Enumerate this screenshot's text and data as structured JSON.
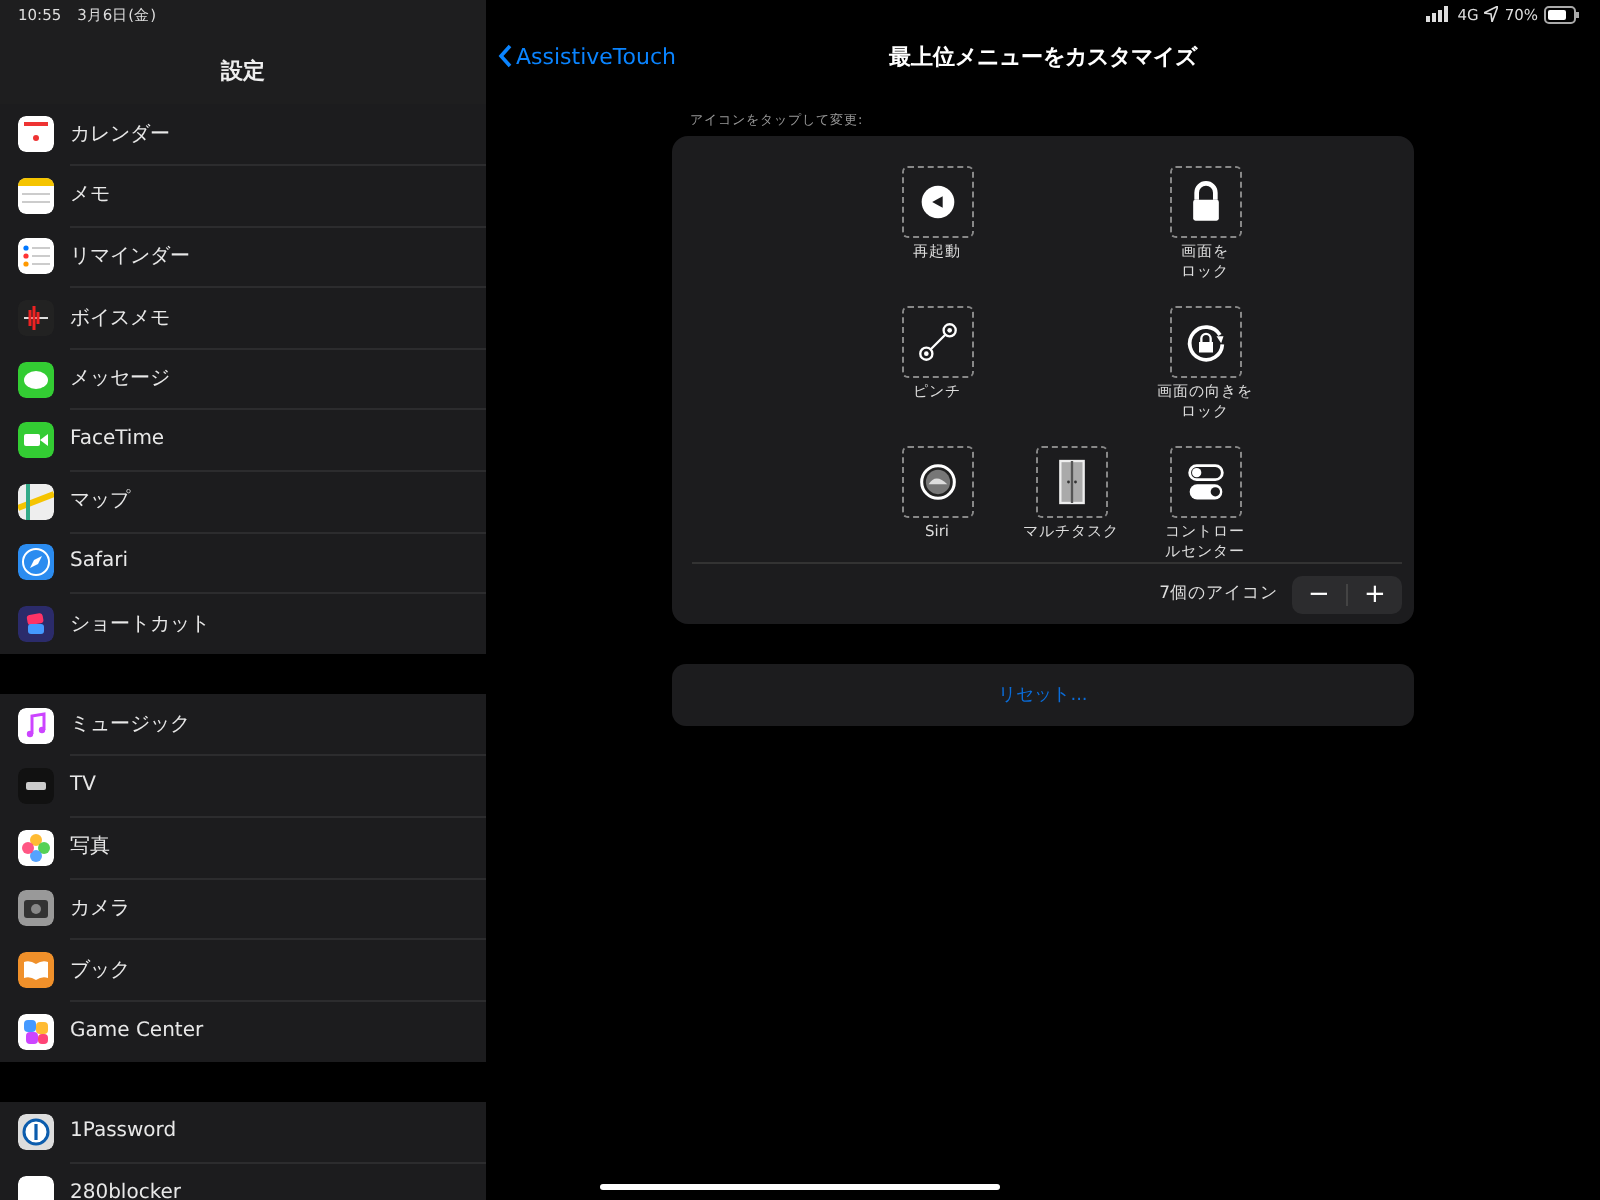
{
  "status_bar": {
    "time": "10:55",
    "date": "3月6日(金)",
    "network": "4G",
    "battery": "70%"
  },
  "sidebar": {
    "title": "設定",
    "groups": [
      {
        "items": [
          {
            "label": "カレンダー"
          },
          {
            "label": "メモ"
          },
          {
            "label": "リマインダー"
          },
          {
            "label": "ボイスメモ"
          },
          {
            "label": "メッセージ"
          },
          {
            "label": "FaceTime"
          },
          {
            "label": "マップ"
          },
          {
            "label": "Safari"
          },
          {
            "label": "ショートカット"
          }
        ]
      },
      {
        "items": [
          {
            "label": "ミュージック"
          },
          {
            "label": "TV"
          },
          {
            "label": "写真"
          },
          {
            "label": "カメラ"
          },
          {
            "label": "ブック"
          },
          {
            "label": "Game Center"
          }
        ]
      },
      {
        "items": [
          {
            "label": "1Password"
          },
          {
            "label": "280blocker"
          }
        ]
      }
    ]
  },
  "detail": {
    "back": "AssistiveTouch",
    "title": "最上位メニューをカスタマイズ",
    "caption": "アイコンをタップして変更:",
    "slots": [
      {
        "kind": "restart",
        "label": "再起動"
      },
      {
        "kind": "lock",
        "label": "画面をロック"
      },
      {
        "kind": "pinch",
        "label": "ピンチ"
      },
      {
        "kind": "rotation-lock",
        "label": "画面の向きをロック"
      },
      {
        "kind": "siri",
        "label": "Siri"
      },
      {
        "kind": "multitask",
        "label": "マルチタスク"
      },
      {
        "kind": "control-center",
        "label": "コントロールセンター"
      }
    ],
    "count": "7個のアイコン",
    "minus": "−",
    "plus": "+",
    "reset": "リセット..."
  }
}
